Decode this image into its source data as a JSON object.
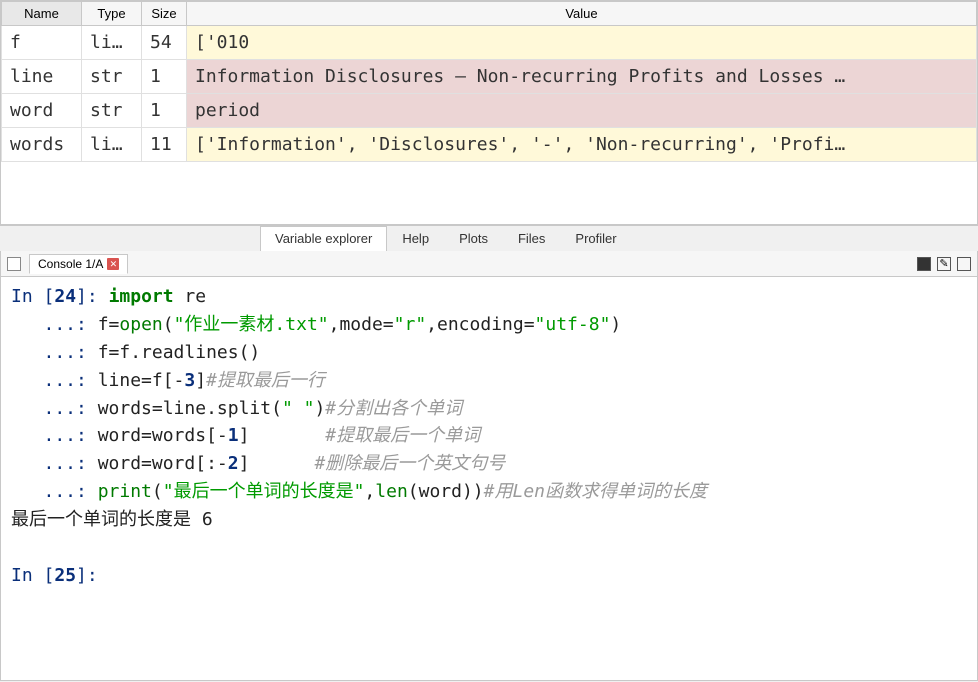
{
  "variable_explorer": {
    "headers": {
      "name": "Name",
      "type": "Type",
      "size": "Size",
      "value": "Value"
    },
    "rows": [
      {
        "name": "f",
        "type": "list",
        "size": "54",
        "value": "['010"
      },
      {
        "name": "line",
        "type": "str",
        "size": "1",
        "value": "Information Disclosures – Non-recurring Profits and Losses …"
      },
      {
        "name": "word",
        "type": "str",
        "size": "1",
        "value": "period"
      },
      {
        "name": "words",
        "type": "list",
        "size": "11",
        "value": "['Information', 'Disclosures', '-', 'Non-recurring', 'Profi…"
      }
    ]
  },
  "tabs": {
    "variable_explorer": "Variable explorer",
    "help": "Help",
    "plots": "Plots",
    "files": "Files",
    "profiler": "Profiler"
  },
  "console": {
    "tab_label": "Console 1/A",
    "prompt_in": "In [",
    "prompt_close": "]: ",
    "cont": "   ...: ",
    "cell_num_24": "24",
    "cell_num_25": "25",
    "code": {
      "l1_kw": "import",
      "l1_mod": " re",
      "l2_a": "f=",
      "l2_open": "open",
      "l2_p1": "(",
      "l2_s1": "\"作业一素材.txt\"",
      "l2_c1": ",mode=",
      "l2_s2": "\"r\"",
      "l2_c2": ",encoding=",
      "l2_s3": "\"utf-8\"",
      "l2_p2": ")",
      "l3": "f=f.readlines()",
      "l4_a": "line=f[-",
      "l4_n": "3",
      "l4_b": "]",
      "l4_cmt": "#提取最后一行",
      "l5_a": "words=line.split(",
      "l5_s": "\" \"",
      "l5_b": ")",
      "l5_cmt": "#分割出各个单词",
      "l6_a": "word=words[-",
      "l6_n": "1",
      "l6_b": "]",
      "l6_cmt": "       #提取最后一个单词",
      "l7_a": "word=word[:-",
      "l7_n": "2",
      "l7_b": "]",
      "l7_cmt": "      #删除最后一个英文句号",
      "l8_print": "print",
      "l8_p1": "(",
      "l8_s": "\"最后一个单词的长度是\"",
      "l8_c": ",",
      "l8_len": "len",
      "l8_p2": "(word))",
      "l8_cmt": "#用Len函数求得单词的长度"
    },
    "output": "最后一个单词的长度是 6"
  }
}
